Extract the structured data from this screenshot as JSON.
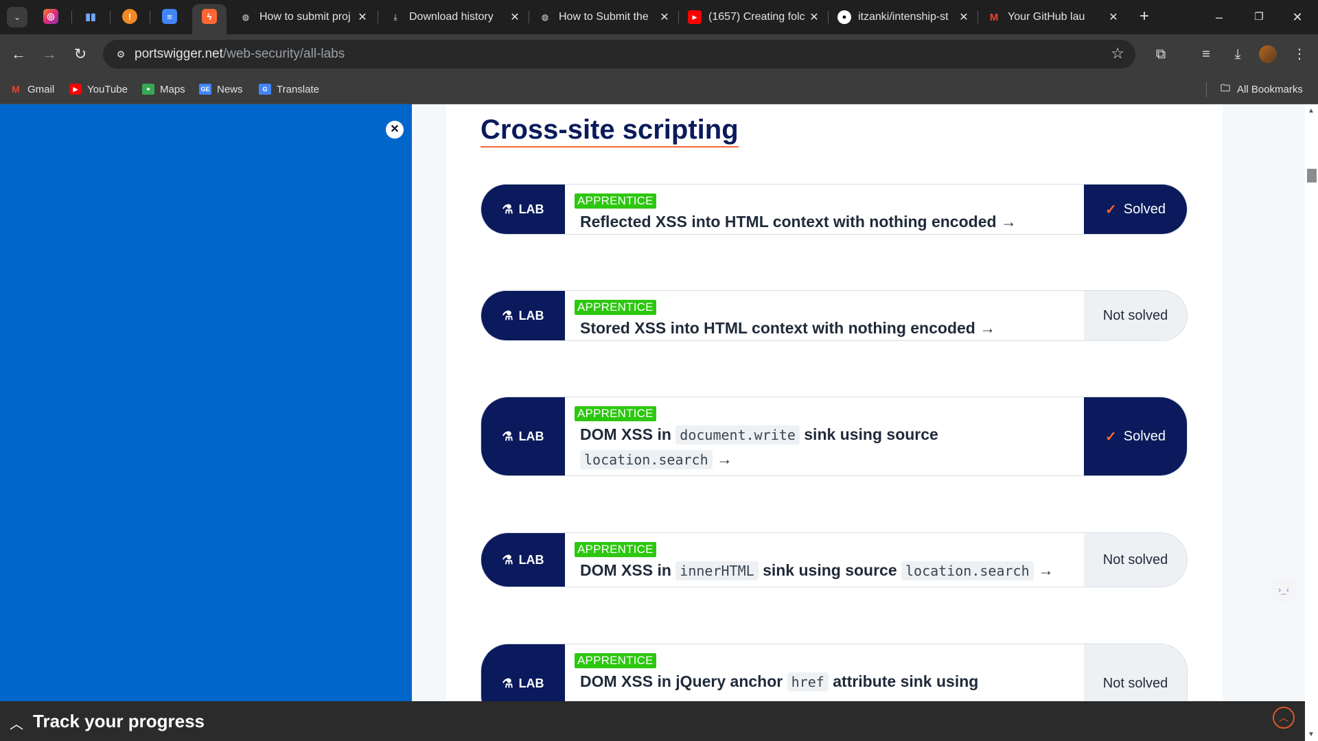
{
  "browser": {
    "tabs": [
      {
        "title": "How to submit proj",
        "icon": "globe-icon"
      },
      {
        "title": "Download history",
        "icon": "download-icon"
      },
      {
        "title": "How to Submit the",
        "icon": "globe-icon"
      },
      {
        "title": "(1657) Creating folc",
        "icon": "youtube-icon"
      },
      {
        "title": "itzanki/intenship-st",
        "icon": "github-icon"
      },
      {
        "title": "Your GitHub lau",
        "icon": "gmail-icon"
      }
    ],
    "url_domain": "portswigger.net",
    "url_path": "/web-security/all-labs",
    "bookmarks": [
      "Gmail",
      "YouTube",
      "Maps",
      "News",
      "Translate"
    ],
    "all_bookmarks": "All Bookmarks"
  },
  "page": {
    "section_title": "Cross-site scripting",
    "lab_badge": "LAB",
    "labs": [
      {
        "level": "APPRENTICE",
        "title_parts": [
          "Reflected XSS into HTML context with nothing encoded →"
        ],
        "status": "Solved",
        "solved": true
      },
      {
        "level": "APPRENTICE",
        "title_parts": [
          "Stored XSS into HTML context with nothing encoded →"
        ],
        "status": "Not solved",
        "solved": false
      },
      {
        "level": "APPRENTICE",
        "title_parts": [
          "DOM XSS in",
          "document.write",
          "sink using source",
          "location.search",
          "→"
        ],
        "status": "Solved",
        "solved": true
      },
      {
        "level": "APPRENTICE",
        "title_parts": [
          "DOM XSS in",
          "innerHTML",
          "sink using source",
          "location.search",
          "→"
        ],
        "status": "Not solved",
        "solved": false
      },
      {
        "level": "APPRENTICE",
        "title_parts": [
          "DOM XSS in jQuery anchor",
          "href",
          "attribute sink using"
        ],
        "status": "Not solved",
        "solved": false
      }
    ],
    "progress_label": "Track your progress"
  },
  "colors": {
    "navy": "#0a1a5c",
    "panel_blue": "#0066cc",
    "apprentice_green": "#2cc70f",
    "accent_orange": "#ff6633"
  }
}
